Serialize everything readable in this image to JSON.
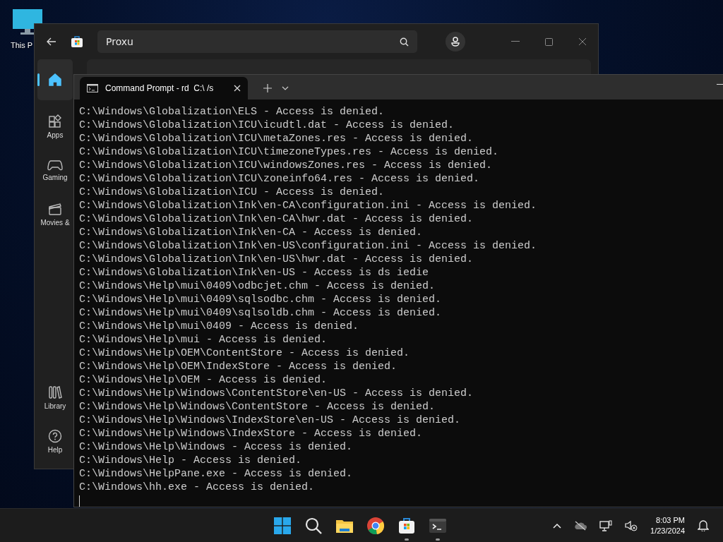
{
  "desktop": {
    "icons": [
      {
        "label": "This P"
      }
    ]
  },
  "store_window": {
    "search": {
      "value": "Proxu"
    },
    "nav": [
      {
        "kind": "home",
        "selected": true
      },
      {
        "label": "Apps",
        "kind": "apps",
        "selected": false
      },
      {
        "label": "Gaming",
        "kind": "gaming",
        "selected": false
      },
      {
        "label": "Movies &",
        "kind": "movies",
        "selected": false
      },
      {
        "label": "Library",
        "kind": "library",
        "selected": false
      },
      {
        "label": "Help",
        "kind": "help",
        "selected": false
      }
    ]
  },
  "terminal": {
    "tab": {
      "title": "Command Prompt - rd  C:\\ /s"
    },
    "lines": [
      "C:\\Windows\\Globalization\\ELS - Access is denied.",
      "C:\\Windows\\Globalization\\ICU\\icudtl.dat - Access is denied.",
      "C:\\Windows\\Globalization\\ICU\\metaZones.res - Access is denied.",
      "C:\\Windows\\Globalization\\ICU\\timezoneTypes.res - Access is denied.",
      "C:\\Windows\\Globalization\\ICU\\windowsZones.res - Access is denied.",
      "C:\\Windows\\Globalization\\ICU\\zoneinfo64.res - Access is denied.",
      "C:\\Windows\\Globalization\\ICU - Access is denied.",
      "C:\\Windows\\Globalization\\Ink\\en-CA\\configuration.ini - Access is denied.",
      "C:\\Windows\\Globalization\\Ink\\en-CA\\hwr.dat - Access is denied.",
      "C:\\Windows\\Globalization\\Ink\\en-CA - Access is denied.",
      "C:\\Windows\\Globalization\\Ink\\en-US\\configuration.ini - Access is denied.",
      "C:\\Windows\\Globalization\\Ink\\en-US\\hwr.dat - Access is denied.",
      "C:\\Windows\\Globalization\\Ink\\en-US - Access is ds iedie",
      "C:\\Windows\\Help\\mui\\0409\\odbcjet.chm - Access is denied.",
      "C:\\Windows\\Help\\mui\\0409\\sqlsodbc.chm - Access is denied.",
      "C:\\Windows\\Help\\mui\\0409\\sqlsoldb.chm - Access is denied.",
      "C:\\Windows\\Help\\mui\\0409 - Access is denied.",
      "C:\\Windows\\Help\\mui - Access is denied.",
      "C:\\Windows\\Help\\OEM\\ContentStore - Access is denied.",
      "C:\\Windows\\Help\\OEM\\IndexStore - Access is denied.",
      "C:\\Windows\\Help\\OEM - Access is denied.",
      "C:\\Windows\\Help\\Windows\\ContentStore\\en-US - Access is denied.",
      "C:\\Windows\\Help\\Windows\\ContentStore - Access is denied.",
      "C:\\Windows\\Help\\Windows\\IndexStore\\en-US - Access is denied.",
      "C:\\Windows\\Help\\Windows\\IndexStore - Access is denied.",
      "C:\\Windows\\Help\\Windows - Access is denied.",
      "C:\\Windows\\Help - Access is denied.",
      "C:\\Windows\\HelpPane.exe - Access is denied.",
      "C:\\Windows\\hh.exe - Access is denied."
    ]
  },
  "taskbar": {
    "apps": [
      {
        "kind": "start"
      },
      {
        "kind": "search"
      },
      {
        "kind": "explorer"
      },
      {
        "kind": "browser"
      },
      {
        "kind": "store",
        "running": true
      },
      {
        "kind": "terminal",
        "running": true
      }
    ],
    "clock": {
      "time": "8:03 PM",
      "date": "1/23/2024"
    }
  }
}
